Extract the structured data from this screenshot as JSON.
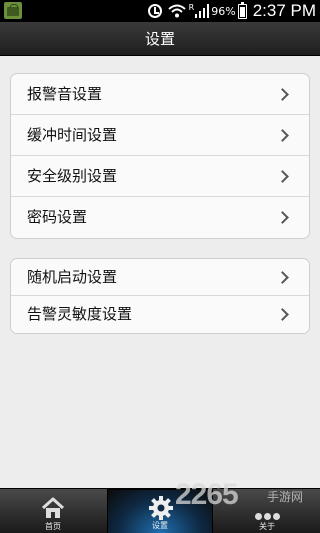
{
  "status_bar": {
    "r_indicator": "R",
    "battery_percent": "96%",
    "time": "2:37 PM"
  },
  "title": "设置",
  "groups": [
    {
      "items": [
        {
          "label": "报警音设置"
        },
        {
          "label": "缓冲时间设置"
        },
        {
          "label": "安全级别设置"
        },
        {
          "label": "密码设置"
        }
      ]
    },
    {
      "items": [
        {
          "label": "随机启动设置"
        },
        {
          "label": "告警灵敏度设置"
        }
      ]
    }
  ],
  "tabs": [
    {
      "label": "首页",
      "icon": "home-icon"
    },
    {
      "label": "设置",
      "icon": "gear-icon",
      "active": true
    },
    {
      "label": "关于",
      "icon": "more-icon"
    }
  ],
  "watermark": {
    "number": "2265",
    "text": "手游网"
  }
}
